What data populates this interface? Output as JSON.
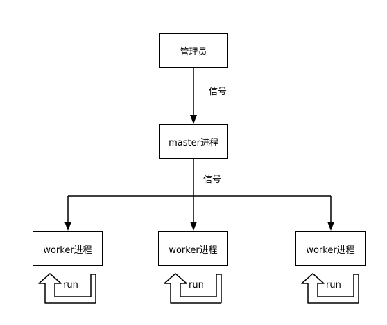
{
  "nodes": {
    "admin": "管理员",
    "master": "master进程",
    "workers": [
      "worker进程",
      "worker进程",
      "worker进程"
    ]
  },
  "edges": {
    "admin_to_master": "信号",
    "master_to_workers": "信号"
  },
  "loops": [
    "run",
    "run",
    "run"
  ]
}
